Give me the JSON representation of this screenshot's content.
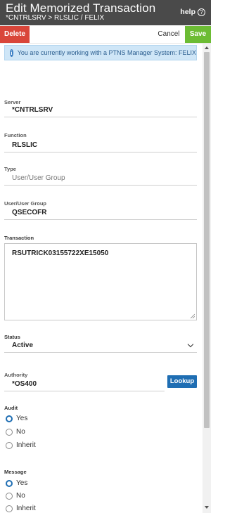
{
  "header": {
    "title": "Edit Memorized Transaction",
    "subtitle": "*CNTRLSRV > RLSLIC / FELIX",
    "help_label": "help",
    "help_icon": "?"
  },
  "toolbar": {
    "delete_label": "Delete",
    "cancel_label": "Cancel",
    "save_label": "Save"
  },
  "info": {
    "text": "You are currently working with a PTNS Manager System: FELIX",
    "icon": "i"
  },
  "fields": {
    "server": {
      "label": "Server",
      "value": "*CNTRLSRV"
    },
    "function": {
      "label": "Function",
      "value": "RLSLIC"
    },
    "type": {
      "label": "Type",
      "value": "User/User Group"
    },
    "user_group": {
      "label": "User/User Group",
      "value": "QSECOFR"
    },
    "transaction": {
      "label": "Transaction",
      "value": "RSUTRICK03155722XE15050"
    },
    "status": {
      "label": "Status",
      "value": "Active"
    },
    "authority": {
      "label": "Authority",
      "value": "*OS400",
      "lookup_label": "Lookup"
    }
  },
  "audit": {
    "label": "Audit",
    "options": [
      "Yes",
      "No",
      "Inherit"
    ],
    "selected": "Yes"
  },
  "message": {
    "label": "Message",
    "options": [
      "Yes",
      "No",
      "Inherit"
    ],
    "selected": "Yes"
  },
  "colors": {
    "header_bg": "#4a4a4a",
    "delete": "#d9463a",
    "save": "#6cbc34",
    "primary": "#1f6eb3",
    "info_bg": "#cfe6f7"
  }
}
